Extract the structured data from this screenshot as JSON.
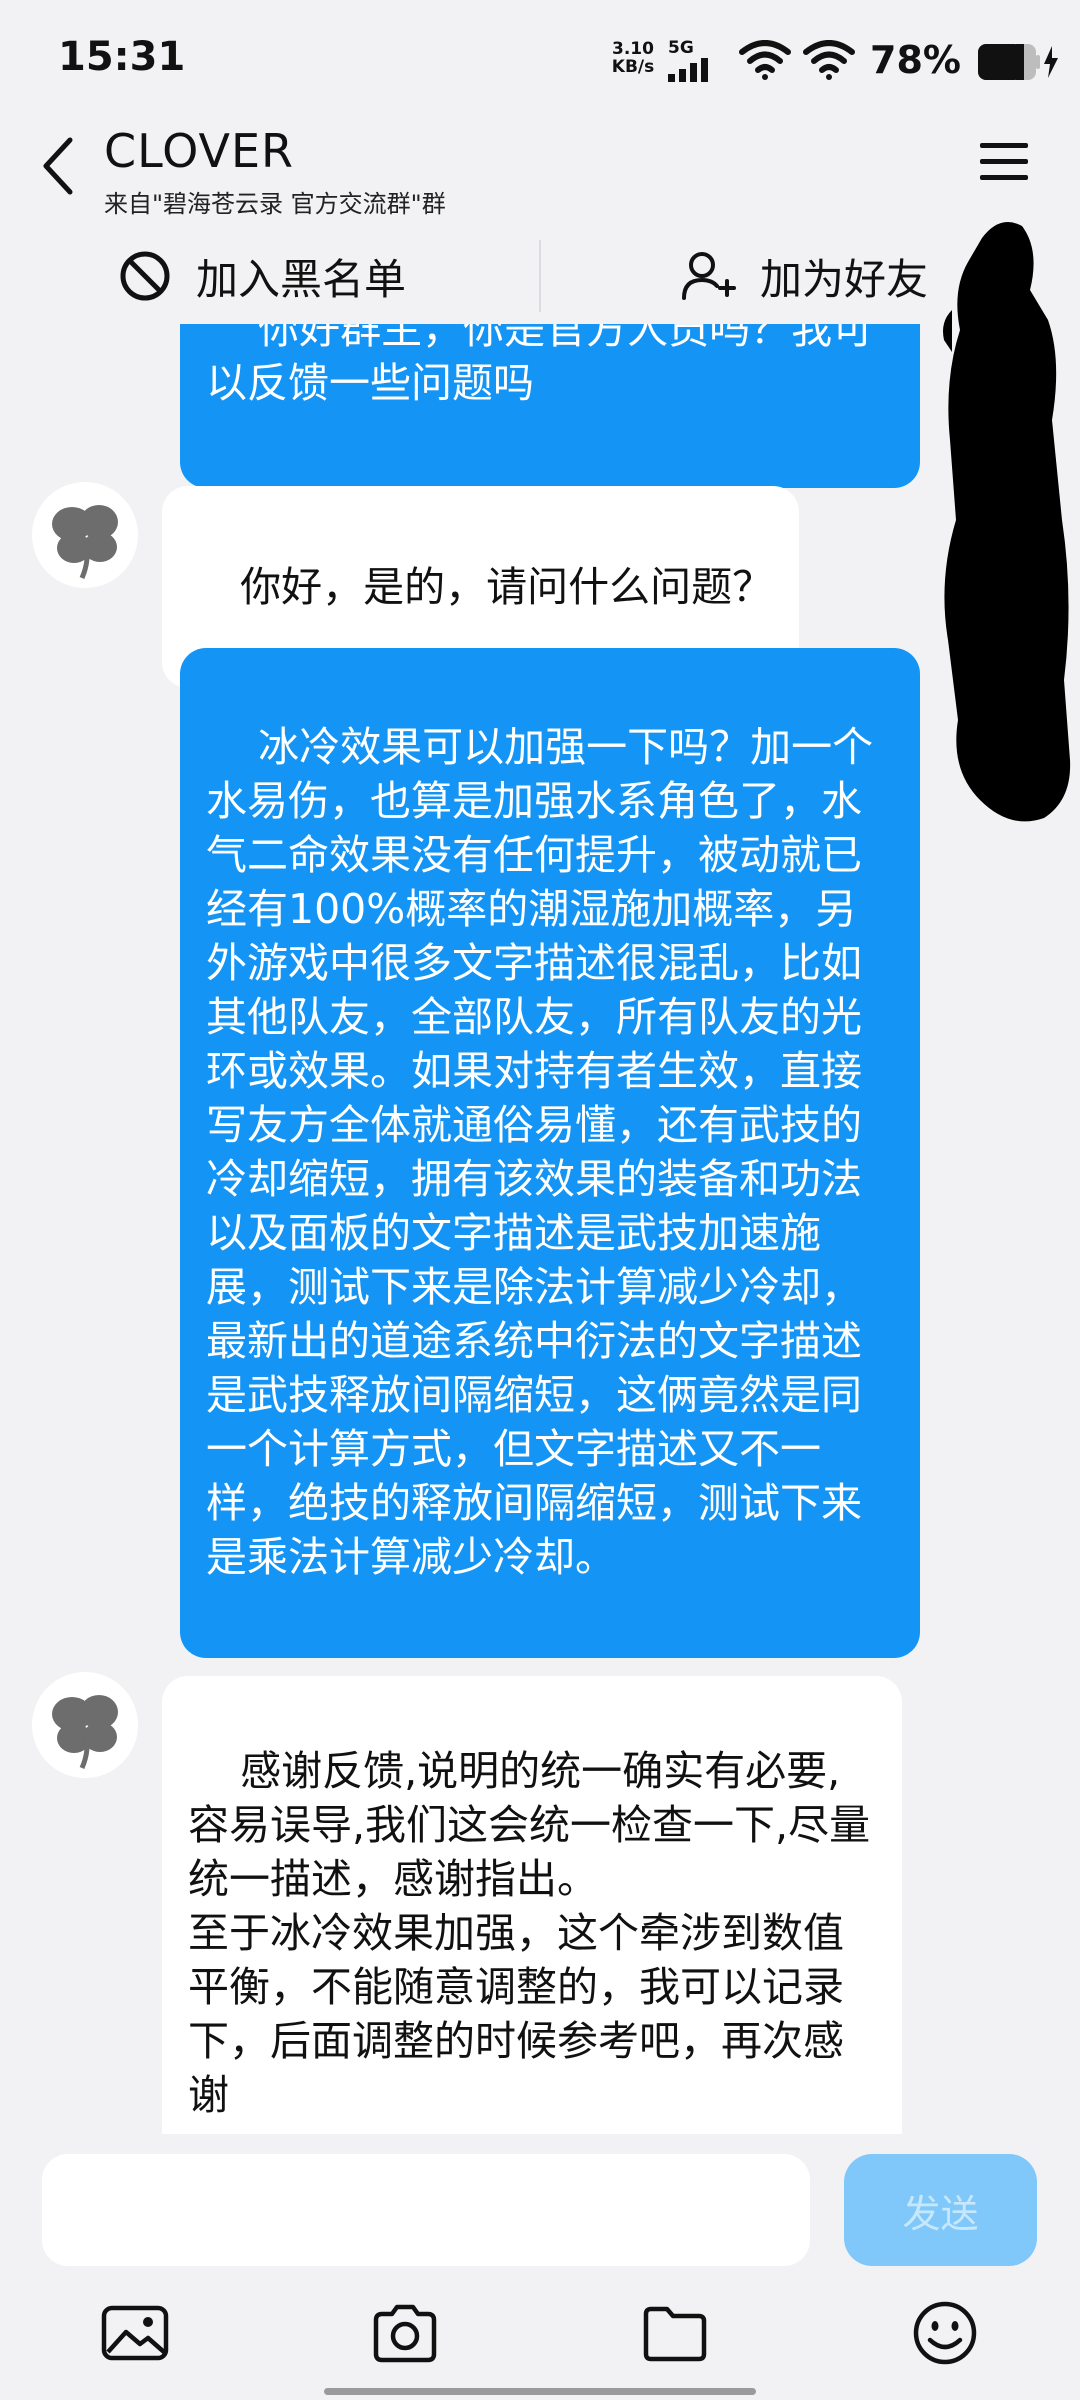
{
  "status_bar": {
    "time": "15:31",
    "net_speed_value": "3.10",
    "net_speed_unit": "KB/s",
    "network_type": "5G",
    "battery_percent": "78%"
  },
  "header": {
    "contact_name": "CLOVER",
    "source_group": "来自\"碧海苍云录 官方交流群\"群"
  },
  "actions": {
    "blacklist_label": "加入黑名单",
    "add_friend_label": "加为好友"
  },
  "messages": [
    {
      "from": "me",
      "text": "你好群主，你是官方人员吗？我可以反馈一些问题吗"
    },
    {
      "from": "CLOVER",
      "text": "你好，是的，请问什么问题？"
    },
    {
      "from": "me",
      "text": "冰冷效果可以加强一下吗？加一个水易伤，也算是加强水系角色了，水气二命效果没有任何提升，被动就已经有100%概率的潮湿施加概率，另外游戏中很多文字描述很混乱，比如其他队友，全部队友，所有队友的光环或效果。如果对持有者生效，直接写友方全体就通俗易懂，还有武技的冷却缩短，拥有该效果的装备和功法以及面板的文字描述是武技加速施展，测试下来是除法计算减少冷却，最新出的道途系统中衍法的文字描述是武技释放间隔缩短，这俩竟然是同一个计算方式，但文字描述又不一样，绝技的释放间隔缩短，测试下来是乘法计算减少冷却。"
    },
    {
      "from": "CLOVER",
      "text": "感谢反馈,说明的统一确实有必要,容易误导,我们这会统一检查一下,尽量统一描述，感谢指出。\n至于冰冷效果加强，这个牵涉到数值平衡，不能随意调整的，我可以记录下，后面调整的时候参考吧，再次感谢"
    }
  ],
  "composer": {
    "input_value": "",
    "send_label": "发送"
  },
  "toolbar_icons": [
    "image-icon",
    "camera-icon",
    "folder-icon",
    "emoji-icon"
  ],
  "colors": {
    "background": "#f2f2f4",
    "my_bubble": "#1495f6",
    "their_bubble": "#ffffff",
    "send_disabled": "#80c8f9"
  }
}
